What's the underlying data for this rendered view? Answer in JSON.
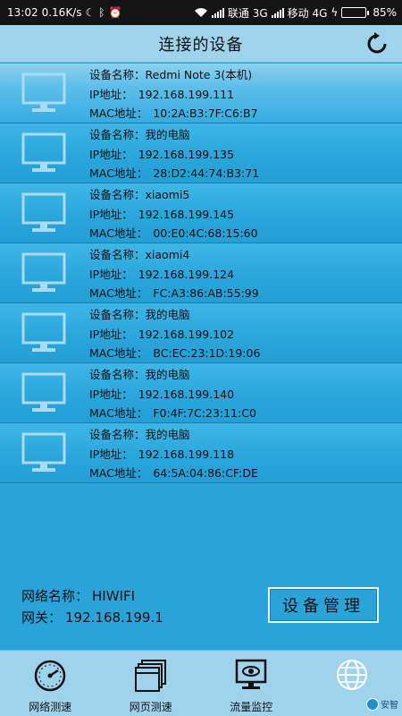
{
  "status_bar": {
    "time": "13:02",
    "speed": "0.16K/s",
    "carrier1": "联通 3G",
    "carrier2": "移动 4G",
    "battery": "85%",
    "battery_level": 0.85
  },
  "header": {
    "title": "连接的设备"
  },
  "device_labels": {
    "name": "设备名称：",
    "ip": "IP地址：",
    "mac": "MAC地址："
  },
  "devices": [
    {
      "name": "Redmi Note 3(本机)",
      "ip": "192.168.199.111",
      "mac": "10:2A:B3:7F:C6:B7"
    },
    {
      "name": "我的电脑",
      "ip": "192.168.199.135",
      "mac": "28:D2:44:74:B3:71"
    },
    {
      "name": "xiaomi5",
      "ip": "192.168.199.145",
      "mac": "00:E0:4C:68:15:60"
    },
    {
      "name": "xiaomi4",
      "ip": "192.168.199.124",
      "mac": "FC:A3:86:AB:55:99"
    },
    {
      "name": "我的电脑",
      "ip": "192.168.199.102",
      "mac": "BC:EC:23:1D:19:06"
    },
    {
      "name": "我的电脑",
      "ip": "192.168.199.140",
      "mac": "F0:4F:7C:23:11:C0"
    },
    {
      "name": "我的电脑",
      "ip": "192.168.199.118",
      "mac": "64:5A:04:86:CF:DE"
    }
  ],
  "network": {
    "name_label": "网络名称：",
    "name": "HIWIFI",
    "gateway_label": "网关：",
    "gateway": "192.168.199.1"
  },
  "manage_button": "设备管理",
  "nav": [
    {
      "label": "网络测速",
      "icon": "speedometer-icon"
    },
    {
      "label": "网页测速",
      "icon": "browser-pages-icon"
    },
    {
      "label": "流量监控",
      "icon": "monitor-eye-icon"
    },
    {
      "label": "",
      "icon": "globe-icon"
    }
  ],
  "watermark": "安智",
  "colors": {
    "accent": "#2aa4d8",
    "header_bg": "#9fd3ec",
    "battery_green": "#3fd23f"
  }
}
